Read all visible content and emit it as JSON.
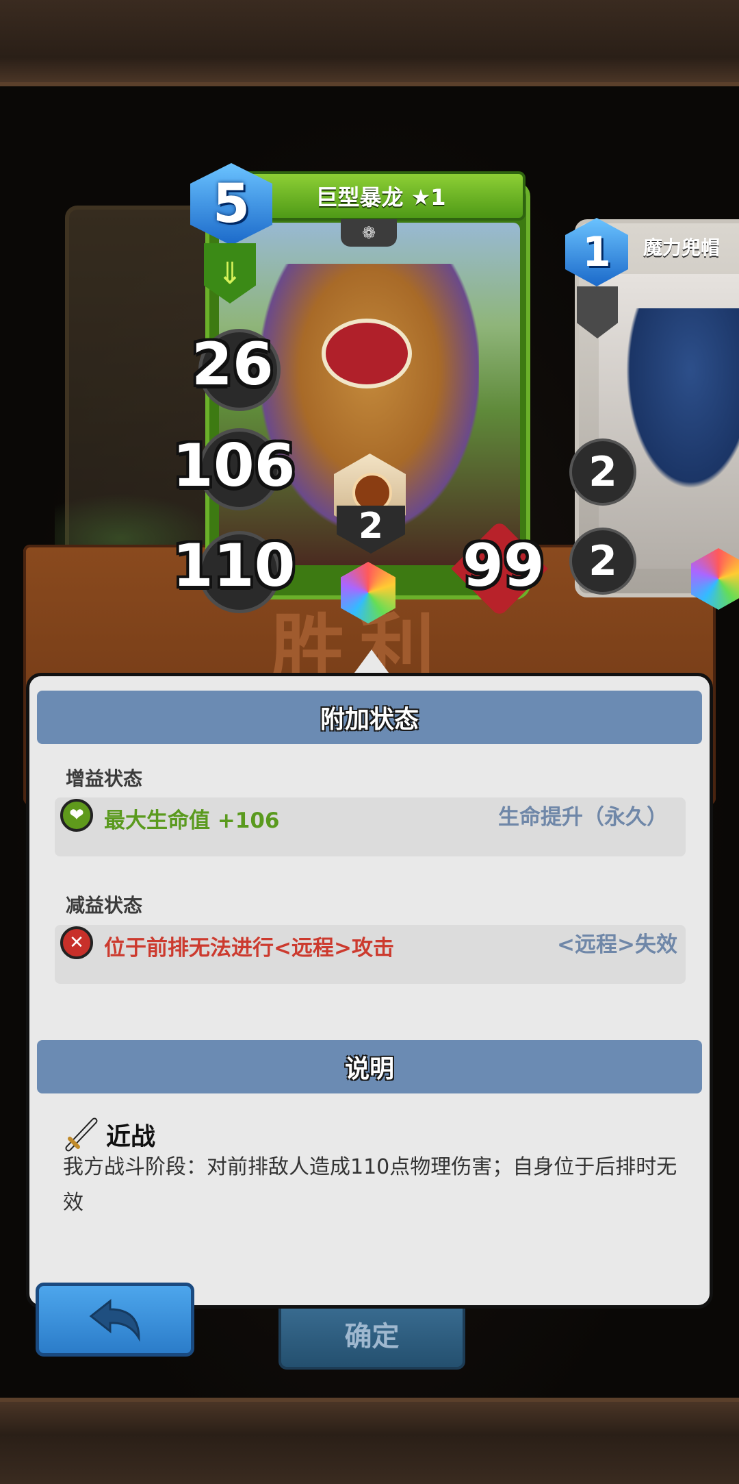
{
  "card": {
    "name": "巨型暴龙 ★1",
    "cost": "5",
    "stat_top": "26",
    "stat_mid": "106",
    "stat_attack": "110",
    "health": "99",
    "skill_count": "2"
  },
  "side_card": {
    "name": "魔力兜帽",
    "cost": "1",
    "stat_top": "2",
    "stat_bottom": "2"
  },
  "background": {
    "victory_text": "胜利",
    "confirm_label": "确定"
  },
  "popup": {
    "status_header": "附加状态",
    "buff_label": "增益状态",
    "buff_text": "最大生命值 +106",
    "buff_tag": "生命提升（永久）",
    "debuff_label": "减益状态",
    "debuff_text": "位于前排无法进行<远程>攻击",
    "debuff_tag": "<远程>失效",
    "desc_header": "说明",
    "skill_name": "近战",
    "skill_desc": "我方战斗阶段：对前排敌人造成110点物理伤害；自身位于后排时无效"
  },
  "colors": {
    "buff_green": "#5a9a1e",
    "debuff_red": "#cc3a2e",
    "header_blue": "#6b8bb3",
    "tag_blue": "#6f87a8"
  },
  "icons": {
    "buff": "heart-icon",
    "debuff": "broken-bow-icon",
    "skill": "sword-icon",
    "back": "return-arrow-icon"
  }
}
